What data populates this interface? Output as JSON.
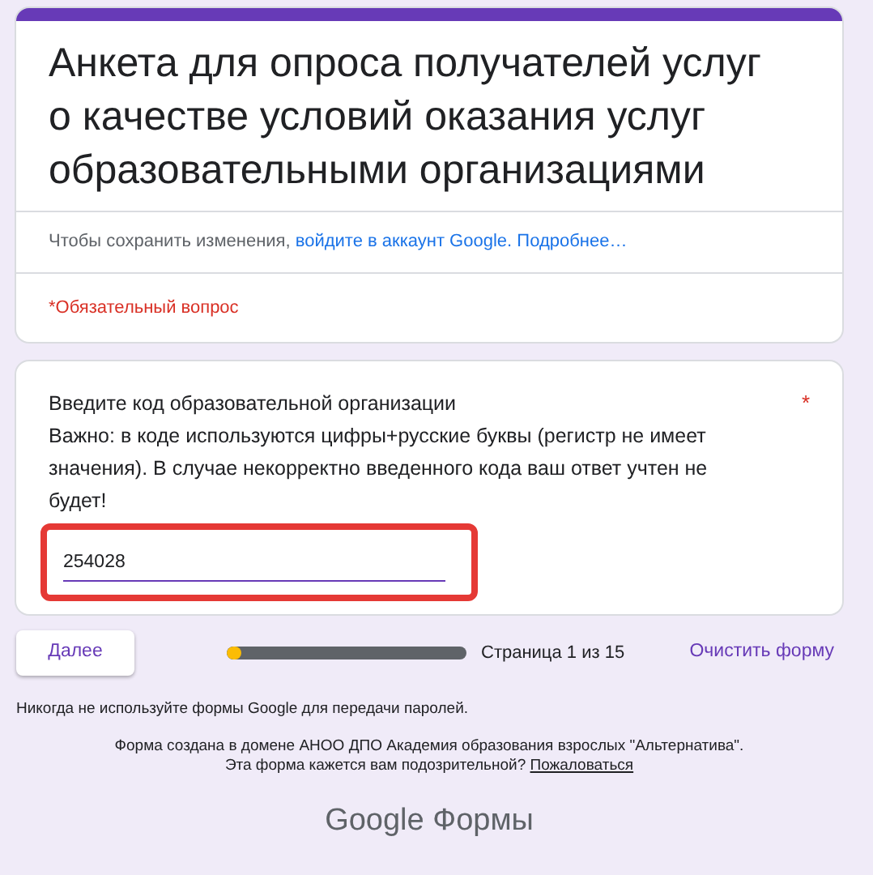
{
  "header": {
    "title": "Анкета для опроса получателей услуг о качестве условий оказания услуг образовательными организациями",
    "sign_in_note": {
      "text": "Чтобы сохранить изменения, ",
      "link": "войдите в аккаунт Google.",
      "more_link": "Подробнее…"
    },
    "required_note": "*Обязательный вопрос"
  },
  "question": {
    "title": "Введите код образовательной организации",
    "description": "Важно: в коде используются цифры+русские буквы (регистр не имеет значения). В случае некорректно введенного кода ваш ответ учтен не будет!",
    "required_mark": "*",
    "value": "254028",
    "highlighted": true
  },
  "navigation": {
    "next_button": "Далее",
    "progress": {
      "level": 0.06,
      "label": "Страница 1 из 15"
    },
    "clear_button": "Очистить форму"
  },
  "footer": {
    "password_warning": "Никогда не используйте формы Google для передачи паролей.",
    "domain_note": "Форма создана в домене АНОО ДПО Академия образования взрослых \"Альтернатива\".",
    "suspicious_note": "Эта форма кажется вам подозрительной?",
    "report_link": "Пожаловаться",
    "logo_google": "Google",
    "logo_product": "Формы"
  }
}
